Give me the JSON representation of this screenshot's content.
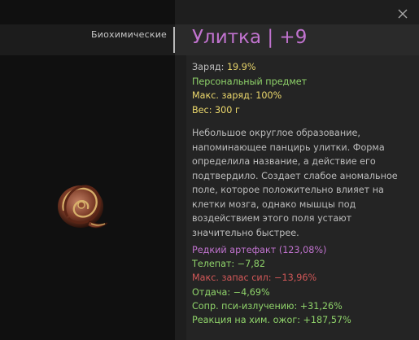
{
  "inventory": {
    "category_label": "Биохимические"
  },
  "tooltip": {
    "title": "Улитка | +9",
    "stats": {
      "charge_label": "Заряд:",
      "charge_value": "19.9%",
      "personal_item": "Персональный предмет",
      "max_charge_label": "Макс. заряд:",
      "max_charge_value": "100%",
      "weight_label": "Вес:",
      "weight_value": "300 г"
    },
    "description": "Небольшое округлое образование,\nнапоминающее панцирь улитки. Форма\nопределила название, а действие его\nподтвердило. Создает слабое аномальное\nполе, которое положительно влияет на\nклетки мозга, однако мышцы под\nвоздействием этого поля устают\nзначительно быстрее.",
    "rarity": "Редкий артефакт (123,08%)",
    "effects": [
      {
        "text": "Телепат: −7,82",
        "color": "green"
      },
      {
        "text": "Макс. запас сил: −13,96%",
        "color": "red"
      },
      {
        "text": "Отдача: −4,69%",
        "color": "green"
      },
      {
        "text": "Сопр. пси-излучению: +31,26%",
        "color": "green"
      },
      {
        "text": "Реакция на хим. ожог: +187,57%",
        "color": "green"
      }
    ]
  },
  "icons": {
    "close": "close-icon",
    "item": "snail-artifact-icon"
  },
  "colors": {
    "rarity": "#c173cf",
    "positive": "#8fd36a",
    "negative": "#d25858",
    "value": "#e6d36a"
  }
}
